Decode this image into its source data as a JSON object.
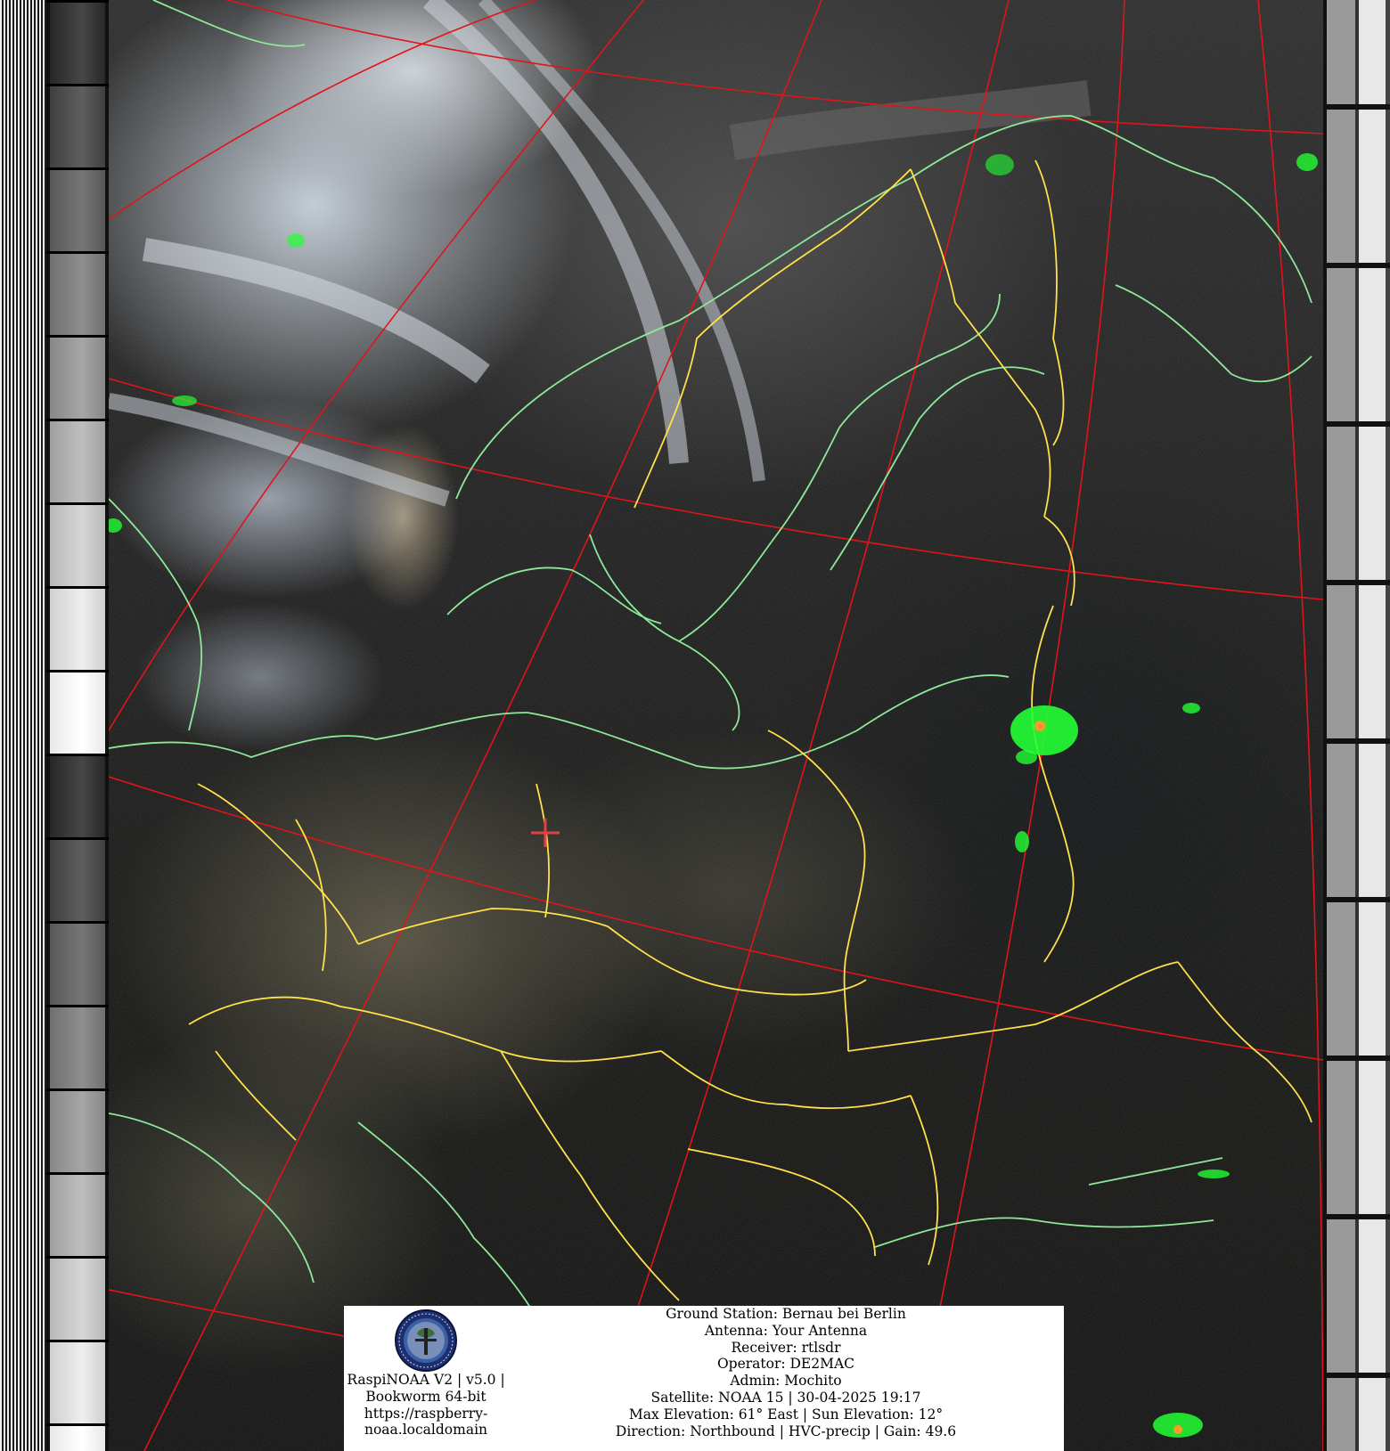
{
  "image": {
    "description_tag": "noaa-apt-satellite-pass",
    "colors": {
      "graticule": "#e0141a",
      "coastline": "#8ee89a",
      "borders": "#ffe14a",
      "precipitation": "#22ff33",
      "crosshair": "#e04040"
    }
  },
  "info_panel": {
    "software": {
      "line1": "RaspiNOAA V2 | v5.0 |",
      "line2": "Bookworm 64-bit",
      "line3": "https://raspberry-",
      "line4": "noaa.localdomain"
    },
    "logo_icon": "raspberry-noaa-satellite-logo",
    "details": [
      "Ground Station: Bernau bei Berlin",
      "Antenna: Your Antenna",
      "Receiver: rtlsdr",
      "Operator: DE2MAC",
      "Admin: Mochito",
      "Satellite: NOAA 15 | 30-04-2025 19:17",
      "Max Elevation: 61° East | Sun Elevation: 12°",
      "Direction: Northbound | HVC-precip | Gain: 49.6"
    ]
  }
}
